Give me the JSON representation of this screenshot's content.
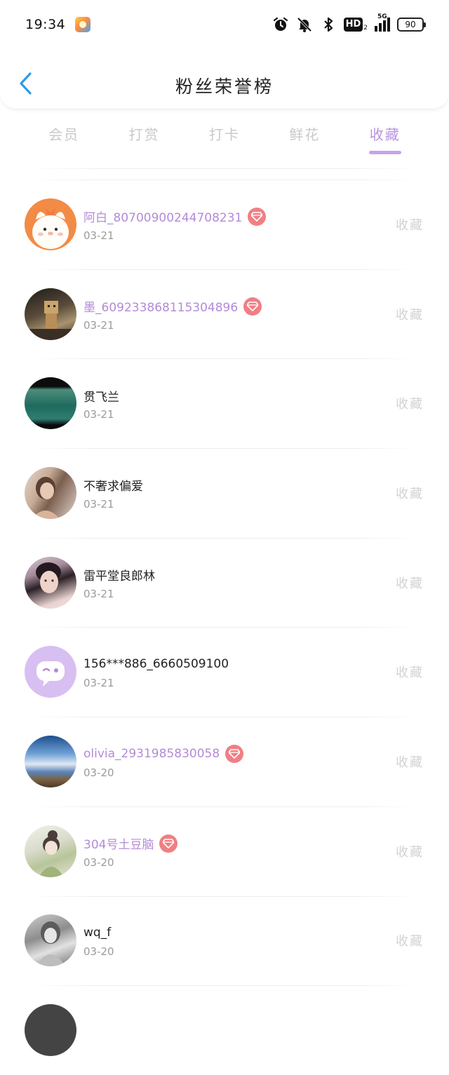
{
  "status_bar": {
    "time": "19:34",
    "signal_label": "5G",
    "hd_label": "HD",
    "hd_sub": "2",
    "battery": "90",
    "icons": [
      "app-icon",
      "alarm-icon",
      "mute-bell-icon",
      "bluetooth-icon",
      "hd-icon",
      "signal-icon",
      "battery-icon"
    ]
  },
  "header": {
    "title": "粉丝荣誉榜",
    "back_icon": "chevron-left-icon"
  },
  "tabs": [
    {
      "label": "会员",
      "active": false
    },
    {
      "label": "打赏",
      "active": false
    },
    {
      "label": "打卡",
      "active": false
    },
    {
      "label": "鲜花",
      "active": false
    },
    {
      "label": "收藏",
      "active": true
    }
  ],
  "colors": {
    "accent": "#b893dd",
    "vip_name": "#b48ad8",
    "gem_badge": "#f07f84",
    "inactive_tab": "#c9c9c9",
    "date": "#9b9b9b",
    "action": "#d2d2d2"
  },
  "list": {
    "action_label": "收藏",
    "items": [
      {
        "name": "阿白_80700900244708231",
        "date": "03-21",
        "vip": true
      },
      {
        "name": "墨_609233868115304896",
        "date": "03-21",
        "vip": true
      },
      {
        "name": "贯飞兰",
        "date": "03-21",
        "vip": false
      },
      {
        "name": "不奢求偏爱",
        "date": "03-21",
        "vip": false
      },
      {
        "name": "雷平堂良郎林",
        "date": "03-21",
        "vip": false
      },
      {
        "name": "156***886_6660509100",
        "date": "03-21",
        "vip": false
      },
      {
        "name": "olivia_2931985830058",
        "date": "03-20",
        "vip": true
      },
      {
        "name": "304号土豆脑",
        "date": "03-20",
        "vip": true
      },
      {
        "name": "wq_f",
        "date": "03-20",
        "vip": false
      }
    ]
  }
}
